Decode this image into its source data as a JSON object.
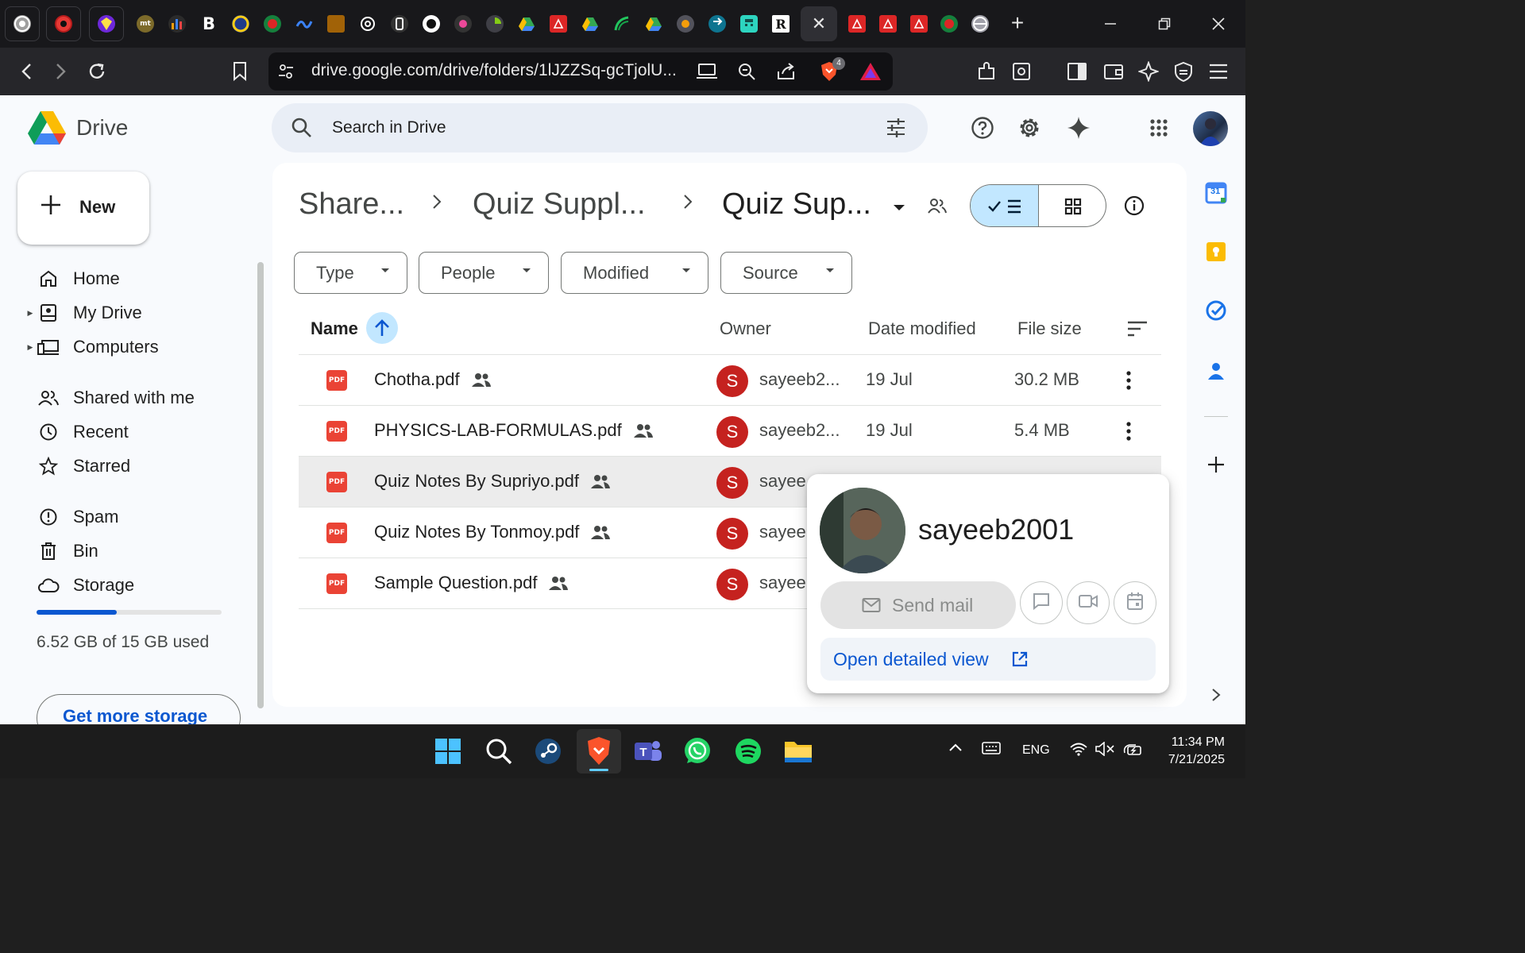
{
  "browser": {
    "active_tab_close": "✕",
    "new_tab": "+",
    "url": "drive.google.com/drive/folders/1lJZZSq-gcTjolU...",
    "shield_count": "4",
    "tab_favicons": [
      "settings-icon",
      "youtube-icon",
      "vpn-icon",
      "mt-icon",
      "analytics-icon",
      "bold-b-icon",
      "chrome-icon",
      "bangla-icon",
      "wave-icon",
      "gov-icon",
      "openai-icon",
      "phone-icon",
      "github-icon",
      "record-icon",
      "pie-icon",
      "drive-icon",
      "pdf-icon",
      "drive-icon",
      "leaf-icon",
      "drive-icon",
      "circle-icon",
      "swap-icon",
      "calculator-icon",
      "rg-icon",
      "pdf-icon",
      "pdf-icon",
      "pdf-icon",
      "bangla-icon",
      "globe-icon"
    ],
    "bold_b": "B",
    "rg": "R",
    "mt": "mt"
  },
  "app": {
    "name": "Drive",
    "search_placeholder": "Search in Drive"
  },
  "sidebar": {
    "new_label": "New",
    "items": [
      {
        "label": "Home",
        "icon": "home-icon"
      },
      {
        "label": "My Drive",
        "icon": "my-drive-icon"
      },
      {
        "label": "Computers",
        "icon": "computers-icon"
      },
      {
        "label": "Shared with me",
        "icon": "people-icon"
      },
      {
        "label": "Recent",
        "icon": "clock-icon"
      },
      {
        "label": "Starred",
        "icon": "star-icon"
      },
      {
        "label": "Spam",
        "icon": "spam-icon"
      },
      {
        "label": "Bin",
        "icon": "bin-icon"
      },
      {
        "label": "Storage",
        "icon": "cloud-icon"
      }
    ],
    "storage_used_fraction": 0.435,
    "storage_text": "6.52 GB of 15 GB used",
    "get_storage": "Get more storage"
  },
  "breadcrumb": [
    "Share...",
    "Quiz Suppl...",
    "Quiz Sup..."
  ],
  "filters": [
    "Type",
    "People",
    "Modified",
    "Source"
  ],
  "columns": {
    "name": "Name",
    "owner": "Owner",
    "date": "Date modified",
    "size": "File size"
  },
  "files": [
    {
      "name": "Chotha.pdf",
      "owner_initial": "S",
      "owner": "sayeeb2...",
      "date": "19 Jul",
      "size": "30.2 MB"
    },
    {
      "name": "PHYSICS-LAB-FORMULAS.pdf",
      "owner_initial": "S",
      "owner": "sayeeb2...",
      "date": "19 Jul",
      "size": "5.4 MB"
    },
    {
      "name": "Quiz Notes By Supriyo.pdf",
      "owner_initial": "S",
      "owner": "sayee",
      "date": "",
      "size": ""
    },
    {
      "name": "Quiz Notes By Tonmoy.pdf",
      "owner_initial": "S",
      "owner": "sayee",
      "date": "",
      "size": ""
    },
    {
      "name": "Sample Question.pdf",
      "owner_initial": "S",
      "owner": "sayee",
      "date": "",
      "size": ""
    }
  ],
  "file_badge": "PDF",
  "hovercard": {
    "name": "sayeeb2001",
    "send_mail": "Send mail",
    "open_detail": "Open detailed view"
  },
  "side_panel": {
    "calendar_day": "31"
  },
  "taskbar": {
    "lang": "ENG",
    "time": "11:34 PM",
    "date": "7/21/2025",
    "teams_letter": "T"
  },
  "colors": {
    "accent": "#0b57d0",
    "selected": "#c2e7ff",
    "pdf": "#ea4335",
    "owner_avatar": "#c5221f"
  }
}
